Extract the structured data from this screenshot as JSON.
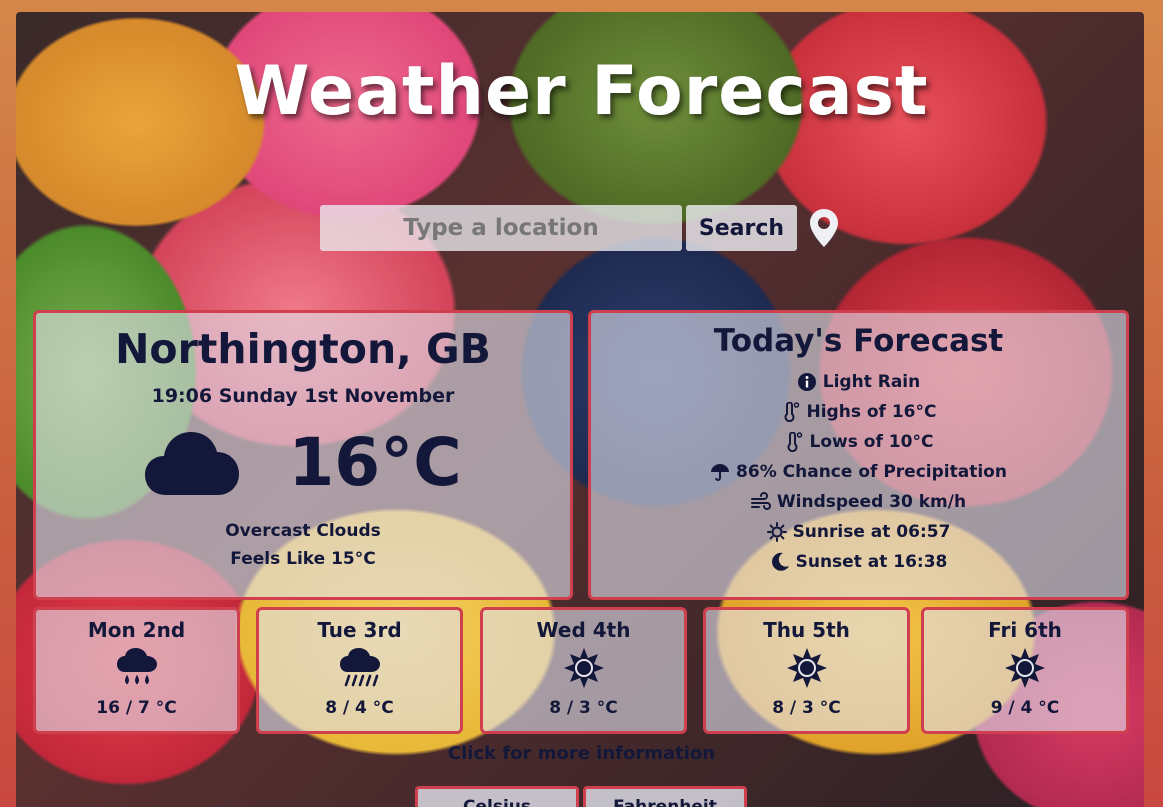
{
  "header": {
    "title": "Weather Forecast"
  },
  "search": {
    "placeholder": "Type a location",
    "button_label": "Search",
    "icon": "map-pin-icon"
  },
  "current": {
    "city": "Northington, GB",
    "datetime": "19:06 Sunday 1st November",
    "icon": "cloud-icon",
    "temperature": "16°C",
    "description": "Overcast Clouds",
    "feels_like": "Feels Like 15°C"
  },
  "today": {
    "heading": "Today's Forecast",
    "items": [
      {
        "icon": "info-icon",
        "text": "Light Rain"
      },
      {
        "icon": "thermometer-icon",
        "text": "Highs of 16°C"
      },
      {
        "icon": "thermometer-icon",
        "text": "Lows of 10°C"
      },
      {
        "icon": "umbrella-icon",
        "text": "86% Chance of Precipitation"
      },
      {
        "icon": "wind-icon",
        "text": "Windspeed 30 km/h"
      },
      {
        "icon": "sun-icon",
        "text": "Sunrise at 06:57"
      },
      {
        "icon": "moon-icon",
        "text": "Sunset at 16:38"
      }
    ]
  },
  "forecast": [
    {
      "day": "Mon 2nd",
      "icon": "cloud-rain-icon",
      "range": "16 / 7 °C"
    },
    {
      "day": "Tue 3rd",
      "icon": "cloud-showers-icon",
      "range": "8 / 4 °C"
    },
    {
      "day": "Wed 4th",
      "icon": "sun-icon",
      "range": "8 / 3 °C"
    },
    {
      "day": "Thu 5th",
      "icon": "sun-icon",
      "range": "8 / 3 °C"
    },
    {
      "day": "Fri 6th",
      "icon": "sun-icon",
      "range": "9 / 4 °C"
    }
  ],
  "more_info": "Click for more information",
  "units": {
    "celsius": "Celsius",
    "fahrenheit": "Fahrenheit"
  },
  "colors": {
    "accent_border": "#cf3f4e",
    "text": "#13183a",
    "title": "#ffffff"
  }
}
